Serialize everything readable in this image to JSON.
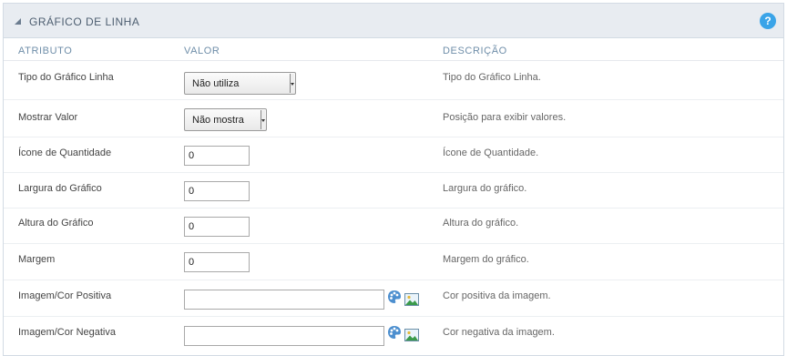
{
  "panel": {
    "title": "GRÁFICO DE LINHA",
    "help": "?"
  },
  "columns": {
    "attribute": "ATRIBUTO",
    "value": "VALOR",
    "description": "DESCRIÇÃO"
  },
  "rows": [
    {
      "label": "Tipo do Gráfico Linha",
      "type": "select",
      "value": "Não utiliza",
      "description": "Tipo do Gráfico Linha."
    },
    {
      "label": "Mostrar Valor",
      "type": "select",
      "value": "Não mostra",
      "description": "Posição para exibir valores."
    },
    {
      "label": "Ícone de Quantidade",
      "type": "text",
      "value": "0",
      "description": "Ícone de Quantidade."
    },
    {
      "label": "Largura do Gráfico",
      "type": "text",
      "value": "0",
      "description": "Largura do gráfico."
    },
    {
      "label": "Altura do Gráfico",
      "type": "text",
      "value": "0",
      "description": "Altura do gráfico."
    },
    {
      "label": "Margem",
      "type": "text",
      "value": "0",
      "description": "Margem do gráfico."
    },
    {
      "label": "Imagem/Cor Positiva",
      "type": "color",
      "value": "",
      "description": "Cor positiva da imagem."
    },
    {
      "label": "Imagem/Cor Negativa",
      "type": "color",
      "value": "",
      "description": "Cor negativa da imagem."
    }
  ],
  "icons": {
    "help": "help-icon",
    "collapse": "collapse-caret-icon",
    "palette": "color-palette-icon",
    "image": "image-picker-icon"
  },
  "colors": {
    "accent": "#3aa4e8",
    "header_bg": "#e8ecf1",
    "column_header": "#6f8ea9"
  }
}
